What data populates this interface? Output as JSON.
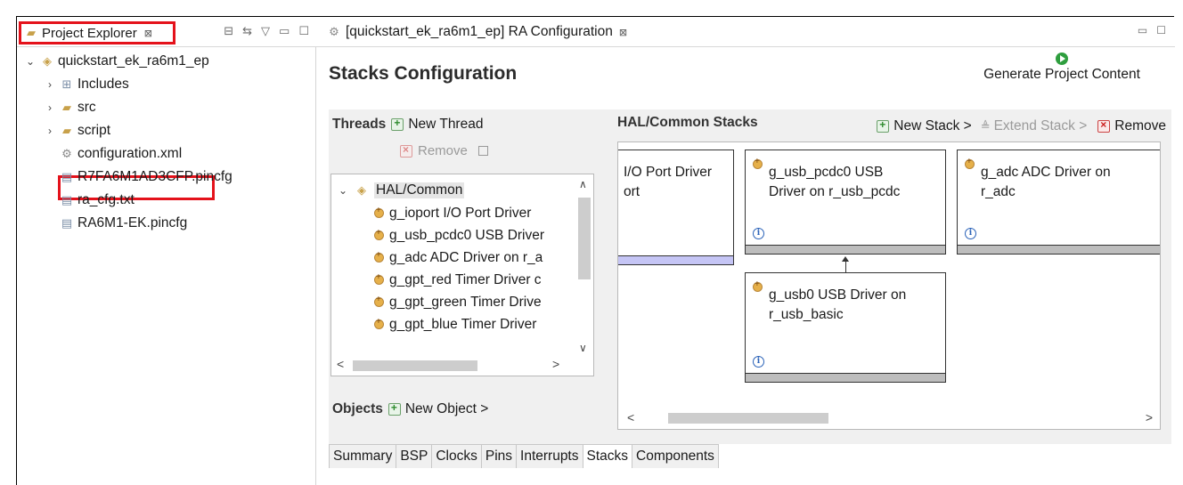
{
  "project_explorer": {
    "tab_label": "Project Explorer",
    "close_glyph": "⊠",
    "tree": {
      "project": "quickstart_ek_ra6m1_ep",
      "items": [
        {
          "label": "Includes",
          "icon": "includes-icon",
          "expandable": true
        },
        {
          "label": "src",
          "icon": "folder-icon",
          "expandable": true
        },
        {
          "label": "script",
          "icon": "folder-icon",
          "expandable": true
        },
        {
          "label": "configuration.xml",
          "icon": "gear-icon",
          "expandable": false
        },
        {
          "label": "R7FA6M1AD3CFP.pincfg",
          "icon": "file-icon",
          "expandable": false
        },
        {
          "label": "ra_cfg.txt",
          "icon": "file-icon",
          "expandable": false
        },
        {
          "label": "RA6M1-EK.pincfg",
          "icon": "file-icon",
          "expandable": false
        }
      ]
    }
  },
  "editor": {
    "tab_label": "[quickstart_ek_ra6m1_ep] RA Configuration",
    "close_glyph": "⊠",
    "title": "Stacks Configuration",
    "generate_label": "Generate Project Content"
  },
  "threads": {
    "header": "Threads",
    "new_thread": "New Thread",
    "remove": "Remove",
    "parent": "HAL/Common",
    "children": [
      "g_ioport I/O Port Driver",
      "g_usb_pcdc0 USB Driver",
      "g_adc ADC Driver on r_a",
      "g_gpt_red Timer Driver c",
      "g_gpt_green Timer Drive",
      "g_gpt_blue Timer Driver"
    ]
  },
  "objects": {
    "header": "Objects",
    "new_object": "New Object >"
  },
  "hal": {
    "header": "HAL/Common Stacks",
    "new_stack": "New Stack >",
    "extend_stack": "Extend Stack >",
    "remove": "Remove",
    "cards": [
      {
        "line1": "I/O Port Driver",
        "line2": "ort"
      },
      {
        "line1": "g_usb_pcdc0 USB",
        "line2": "Driver on r_usb_pcdc"
      },
      {
        "line1": "g_adc ADC Driver on",
        "line2": "r_adc"
      },
      {
        "line1": "g_usb0 USB Driver on",
        "line2": "r_usb_basic"
      }
    ]
  },
  "bottom_tabs": [
    "Summary",
    "BSP",
    "Clocks",
    "Pins",
    "Interrupts",
    "Stacks",
    "Components"
  ],
  "active_tab": "Stacks",
  "colors": {
    "highlight": "#e4121b",
    "generate_icon": "#2e9e3e"
  }
}
